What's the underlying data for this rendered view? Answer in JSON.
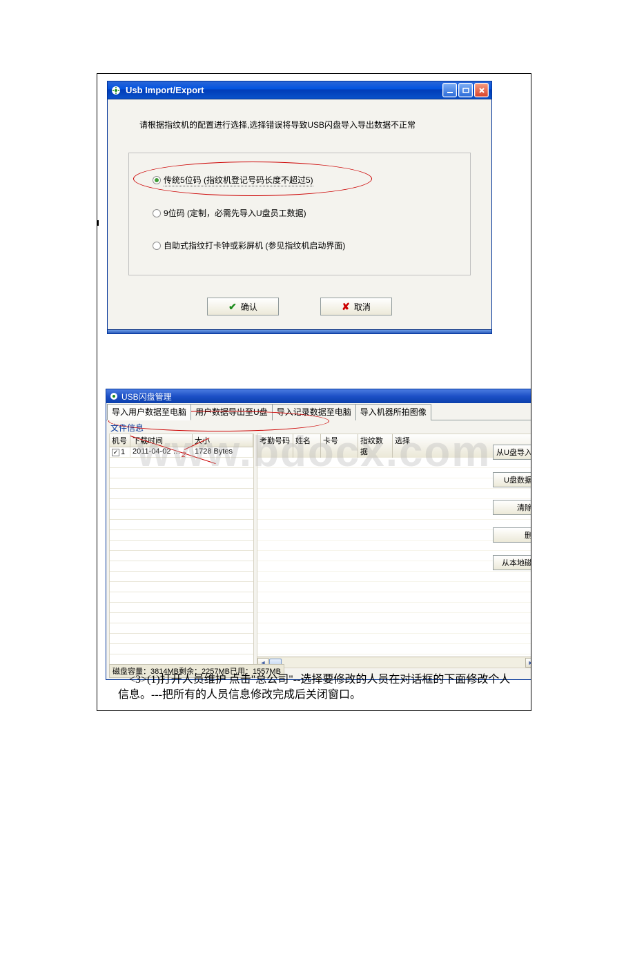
{
  "dialog1": {
    "title": "Usb Import/Export",
    "instruction": "请根据指纹机的配置进行选择,选择错误将导致USB闪盘导入导出数据不正常",
    "radios": {
      "r1": "传统5位码 (指纹机登记号码长度不超过5)",
      "r2": "9位码 (定制，必需先导入U盘员工数据)",
      "r3": "自助式指纹打卡钟或彩屏机 (参见指纹机启动界面)"
    },
    "ok": "确认",
    "cancel": "取消"
  },
  "dialog2": {
    "title": "USB闪盘管理",
    "tabs": {
      "t1": "导入用户数据至电脑",
      "t2": "用户数据导出至U盘",
      "t3": "导入记录数据至电脑",
      "t4": "导入机器所拍图像"
    },
    "fieldset": "文件信息",
    "leftCols": {
      "c1": "机号",
      "c2": "下载时间",
      "c3": "大小"
    },
    "leftRow": {
      "num": "1",
      "time": "2011-04-02 …",
      "size": "1728 Bytes"
    },
    "rightCols": {
      "c1": "考勤号码",
      "c2": "姓名",
      "c3": "卡号",
      "c4": "指纹数据",
      "c5": "选择"
    },
    "sideButtons": {
      "b1": "从U盘导入",
      "b2": "U盘数据",
      "b3": "清除",
      "b4": "删",
      "b5": "从本地磁"
    },
    "status": "磁盘容量：3814MB剩余：2257MB已用：1557MB"
  },
  "annotation2": "2",
  "paragraph": "　<3>(1)打开人员维护 点击\"总公司\"--选择要修改的人员在对话框的下面修改个人信息。---把所有的人员信息修改完成后关闭窗口。",
  "watermark": "www.bdocx.com"
}
